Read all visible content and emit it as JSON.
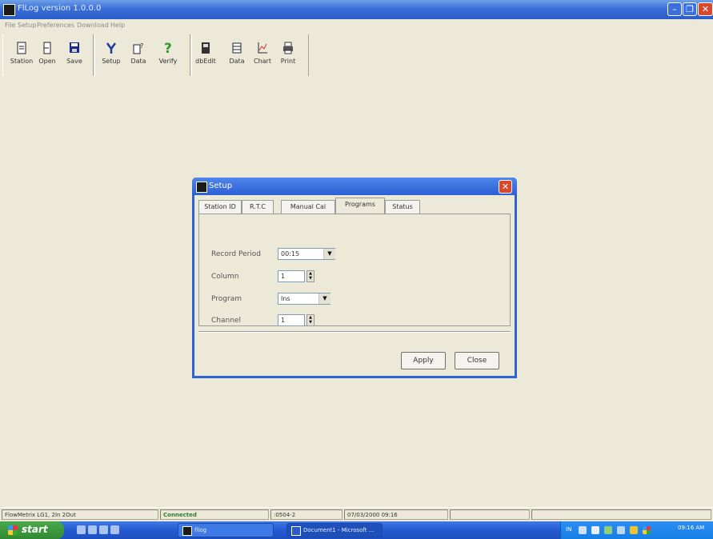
{
  "window": {
    "title": "FlLog version 1.0.0.0",
    "min": "–",
    "max": "❐",
    "close": "✕"
  },
  "menu": [
    "File",
    "Setup",
    "Preferences",
    "Download",
    "Help"
  ],
  "toolbar": [
    {
      "label": "Station",
      "icon": "station-icon"
    },
    {
      "label": "Open",
      "icon": "open-icon"
    },
    {
      "label": "Save",
      "icon": "save-icon"
    },
    {
      "label": "Setup",
      "icon": "setup-icon"
    },
    {
      "label": "Data",
      "icon": "data-icon"
    },
    {
      "label": "Verify",
      "icon": "verify-icon"
    },
    {
      "label": "dbEdit",
      "icon": "dbedit-icon"
    },
    {
      "label": "Data",
      "icon": "data-table-icon"
    },
    {
      "label": "Chart",
      "icon": "chart-icon"
    },
    {
      "label": "Print",
      "icon": "print-icon"
    }
  ],
  "dialog": {
    "title": "Setup",
    "close": "✕",
    "tabs": [
      "Station ID",
      "R.T.C",
      "Manual Cal",
      "Programs",
      "Status"
    ],
    "active_tab": "Programs",
    "fields": {
      "record_period": {
        "label": "Record Period",
        "value": "00:15"
      },
      "column": {
        "label": "Column",
        "value": "1"
      },
      "program": {
        "label": "Program",
        "value": "Ins"
      },
      "channel": {
        "label": "Channel",
        "value": "1"
      }
    },
    "apply_label": "Apply",
    "close_label": "Close"
  },
  "status": [
    "FlowMetrix LG1, 2In 2Out",
    "Connected",
    ":0504-2",
    "07/03/2000 09:16"
  ],
  "status_colors": {
    "connected": "#2e7d32"
  },
  "taskbar": {
    "start_label": "start",
    "tasks": [
      "fllog",
      "Document1 - Microsoft ..."
    ],
    "tray_text": "IN",
    "clock": "09:16 AM"
  }
}
